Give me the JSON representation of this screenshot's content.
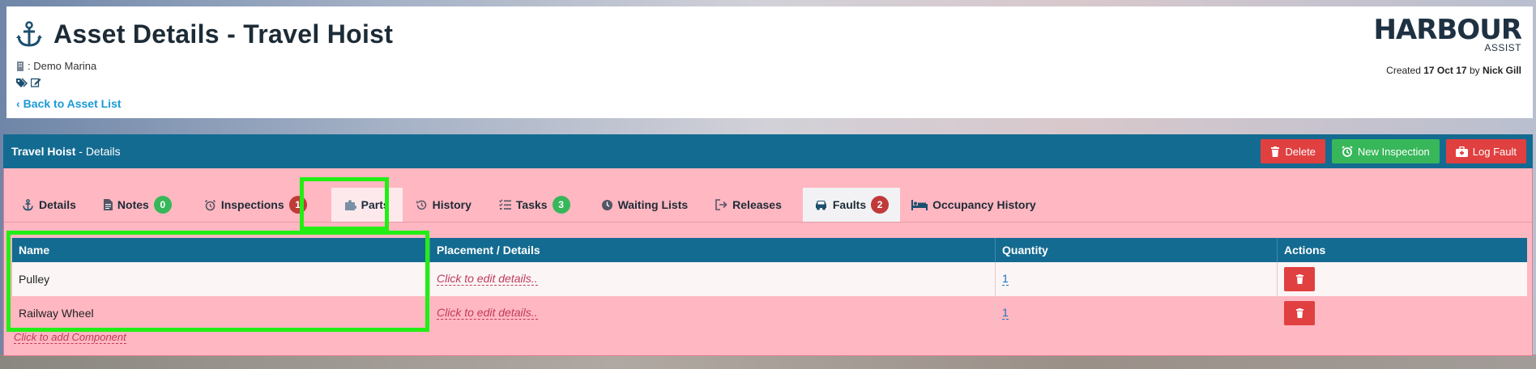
{
  "header": {
    "title": "Asset Details - Travel Hoist",
    "marina": ": Demo Marina",
    "back_link": "Back to Asset List",
    "logo_main": "HARBOUR",
    "logo_sub": "ASSIST",
    "created_prefix": "Created",
    "created_date": "17 Oct 17",
    "created_by_prefix": "by",
    "created_by": "Nick Gill"
  },
  "panel": {
    "title_bold": "Travel Hoist",
    "title_rest": " - Details",
    "buttons": {
      "delete": "Delete",
      "new_inspection": "New Inspection",
      "log_fault": "Log Fault"
    }
  },
  "tabs": [
    {
      "label": "Details"
    },
    {
      "label": "Notes",
      "badge": "0"
    },
    {
      "label": "Inspections",
      "badge": "1"
    },
    {
      "label": "Parts"
    },
    {
      "label": "History"
    },
    {
      "label": "Tasks",
      "badge": "3"
    },
    {
      "label": "Waiting Lists"
    },
    {
      "label": "Releases"
    },
    {
      "label": "Faults",
      "badge": "2"
    },
    {
      "label": "Occupancy History"
    }
  ],
  "table": {
    "headers": [
      "Name",
      "Placement / Details",
      "Quantity",
      "Actions"
    ],
    "rows": [
      {
        "name": "Pulley",
        "details": "Click to edit details..",
        "quantity": "1"
      },
      {
        "name": "Railway Wheel",
        "details": "Click to edit details..",
        "quantity": "1"
      }
    ]
  },
  "add_component": "Click to add Component",
  "colors": {
    "primary": "#146b91",
    "danger": "#e04040",
    "success": "#37b75a",
    "panel_bg": "#ffb7c1",
    "highlight": "#22ee14"
  }
}
